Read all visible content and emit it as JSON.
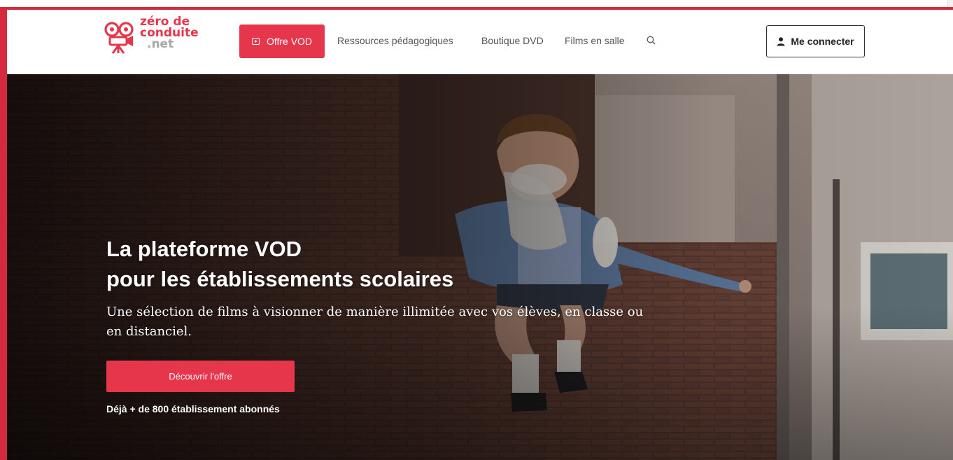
{
  "logo": {
    "line1": "zéro de",
    "line2": "conduite",
    "line3": ".net"
  },
  "nav": {
    "vod_label": "Offre VOD",
    "links": [
      "Ressources pédagogiques",
      "Boutique DVD",
      "Films en salle"
    ],
    "login_label": "Me connecter"
  },
  "hero": {
    "title_line1": "La plateforme VOD",
    "title_line2": "pour les établissements scolaires",
    "subtitle": "Une sélection de films à visionner de manière illimitée avec vos élèves, en classe ou en distanciel.",
    "cta_label": "Découvrir l'offre",
    "note": "Déjà + de 800 établissement abonnés"
  },
  "icons": [
    "camera-logo-icon",
    "play-icon",
    "search-icon",
    "user-icon"
  ],
  "colors": {
    "accent": "#e6364b",
    "text_nav": "#555555",
    "logo_grey": "#a8a8a8"
  }
}
